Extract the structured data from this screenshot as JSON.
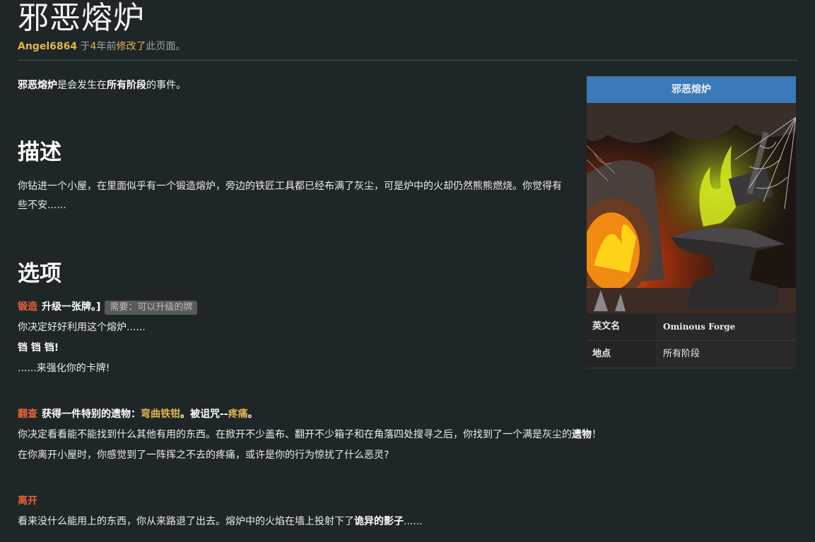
{
  "page": {
    "title": "邪恶熔炉",
    "meta": {
      "author": "Angel6864",
      "prefix": " 于",
      "years": "4",
      "years_suffix": "年前",
      "verb": "修改了",
      "suffix": "此页面。"
    }
  },
  "intro": {
    "name": "邪恶熔炉",
    "text1": "是会发生在",
    "stage": "所有阶段",
    "text2": "的事件。"
  },
  "description": {
    "heading": "描述",
    "body": "你钻进一个小屋，在里面似乎有一个锻造熔炉，旁边的铁匠工具都已经布满了灰尘，可是炉中的火却仍然熊熊燃烧。你觉得有些不安......"
  },
  "options": {
    "heading": "选项",
    "forge": {
      "name": "锻造",
      "desc": "升级一张牌。]",
      "requirement": "需要：可以升级的牌",
      "line1": "你决定好好利用这个熔炉......",
      "line2": "铛 铛 铛!",
      "line3": "......来强化你的卡牌!"
    },
    "rummage": {
      "name": "翻查",
      "desc_a": "获得一件特别的遗物：",
      "relic": "弯曲铁钳",
      "desc_b": "。被诅咒--",
      "curse": "疼痛",
      "desc_c": "。",
      "line1_a": "你决定看看能不能找到什么其他有用的东西。在掀开不少盖布、翻开不少箱子和在角落四处搜寻之后，你找到了一个满是灰尘的",
      "line1_b": "遗物",
      "line1_c": "！",
      "line2": "在你离开小屋时，你感觉到了一阵挥之不去的疼痛，或许是你的行为惊扰了什么恶灵?"
    },
    "leave": {
      "name": "离开",
      "line_a": "看来没什么能用上的东西，你从来路退了出去。熔炉中的火焰在墙上投射下了",
      "line_b": "诡异的影子",
      "line_c": "......"
    }
  },
  "infobox": {
    "title": "邪恶熔炉",
    "rows": [
      {
        "key": "英文名",
        "value": "Ominous Forge"
      },
      {
        "key": "地点",
        "value": "所有阶段"
      }
    ]
  },
  "colors": {
    "background": "#1f2628",
    "accent_gold": "#e0b84a",
    "option_orange": "#e8633c",
    "infobox_header": "#3a7ab8"
  }
}
